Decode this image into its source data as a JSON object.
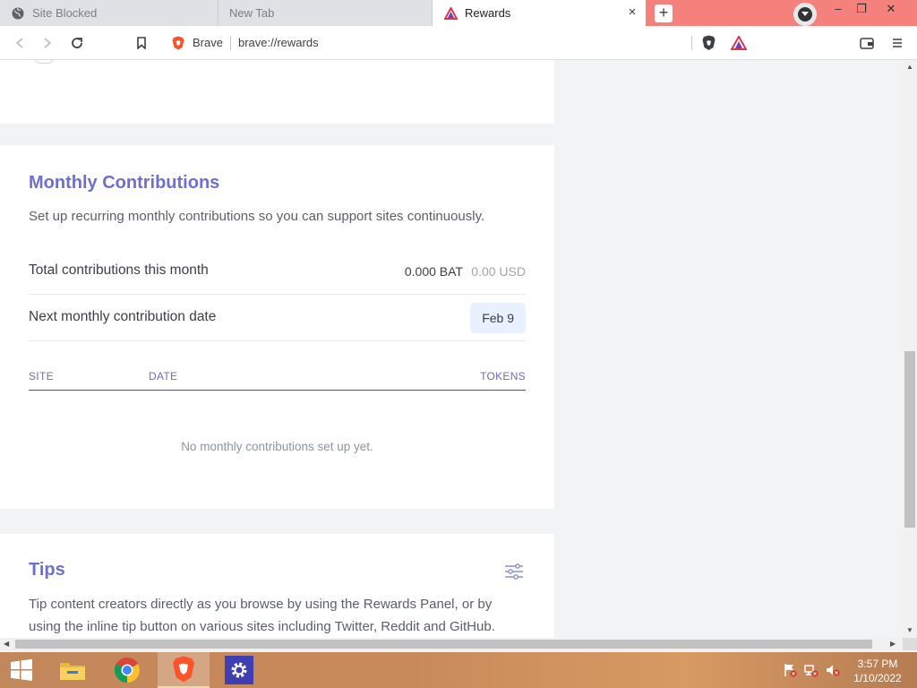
{
  "browser": {
    "tabs": [
      {
        "title": "Site Blocked",
        "icon": "globe-icon"
      },
      {
        "title": "New Tab",
        "icon": ""
      },
      {
        "title": "Rewards",
        "icon": "brave-rewards-icon"
      }
    ],
    "close_glyph": "×",
    "new_tab_glyph": "+",
    "window_controls": [
      "–",
      "❐",
      "✕"
    ],
    "address_bar": {
      "site_label": "Brave",
      "url": "brave://rewards"
    }
  },
  "monthly": {
    "title": "Monthly Contributions",
    "description": "Set up recurring monthly contributions so you can support sites continuously.",
    "total_label": "Total contributions this month",
    "total_bat": "0.000 BAT",
    "total_usd": "0.00 USD",
    "next_date_label": "Next monthly contribution date",
    "next_date_value": "Feb 9",
    "columns": [
      "SITE",
      "DATE",
      "TOKENS"
    ],
    "empty_message": "No monthly contributions set up yet."
  },
  "tips": {
    "title": "Tips",
    "description_line1": "Tip content creators directly as you browse by using the Rewards Panel, or by",
    "description_line2": "using the inline tip button on various sites including Twitter, Reddit and GitHub."
  },
  "taskbar": {
    "apps": [
      "file-explorer-icon",
      "chrome-icon",
      "brave-icon",
      "settings-icon"
    ],
    "clock_time": "3:57 PM",
    "clock_date": "1/10/2022"
  },
  "colors": {
    "titlebar": "#f4817b",
    "accent": "#6e6fd1",
    "brave_orange": "#fb542b"
  }
}
